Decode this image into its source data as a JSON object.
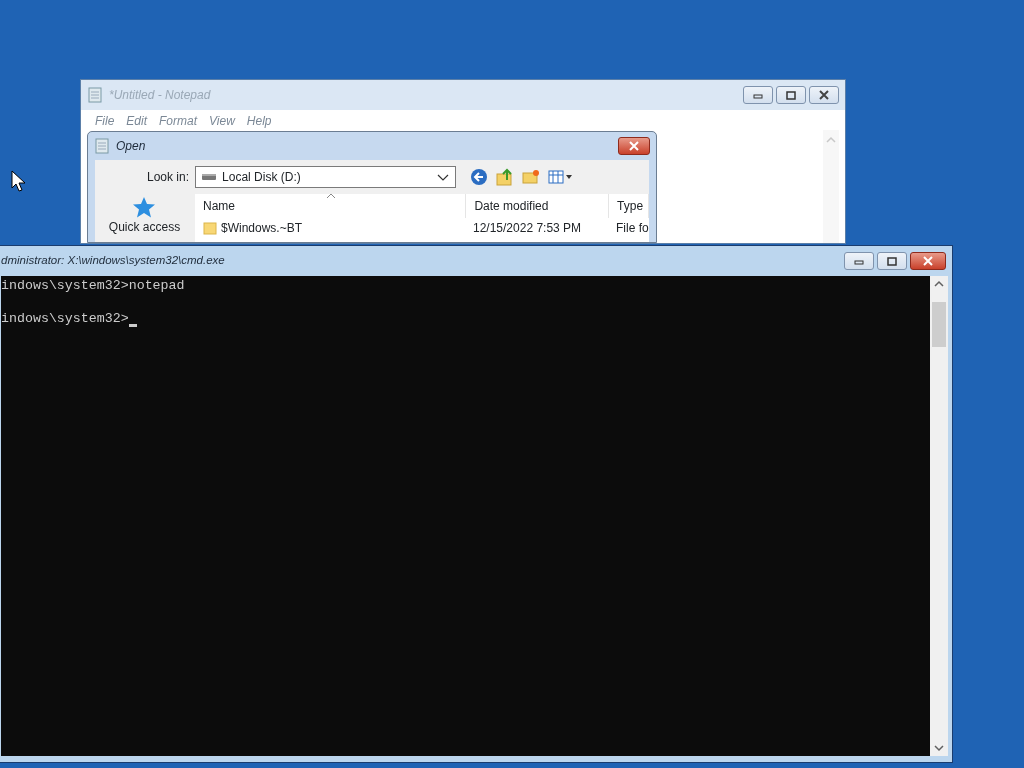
{
  "notepad": {
    "title": "*Untitled - Notepad",
    "menu": [
      "File",
      "Edit",
      "Format",
      "View",
      "Help"
    ]
  },
  "open_dialog": {
    "title": "Open",
    "look_in_label": "Look in:",
    "look_in_value": "Local Disk (D:)",
    "places": [
      "Quick access"
    ],
    "columns": [
      "Name",
      "Date modified",
      "Type"
    ],
    "rows": [
      {
        "name": "$Windows.~BT",
        "date": "12/15/2022 7:53 PM",
        "type": "File fo"
      }
    ]
  },
  "console": {
    "title": "dministrator: X:\\windows\\system32\\cmd.exe",
    "lines": [
      {
        "kind": "text",
        "text": "indows\\system32>notepad",
        "cursor": false
      },
      {
        "kind": "blank"
      },
      {
        "kind": "text",
        "text": "indows\\system32>",
        "cursor": true
      }
    ]
  }
}
